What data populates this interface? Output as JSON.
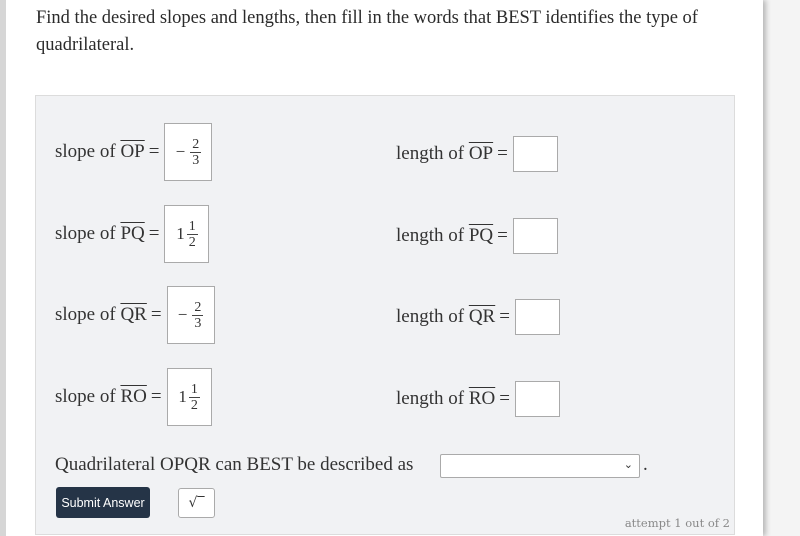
{
  "prompt": "Find the desired slopes and lengths, then fill in the words that BEST identifies the type of quadrilateral.",
  "rows": [
    {
      "slope_label": "slope of",
      "segment": "OP",
      "slope": {
        "sign": "−",
        "whole": "",
        "num": "2",
        "den": "3"
      },
      "length_label": "length of",
      "length_value": ""
    },
    {
      "slope_label": "slope of",
      "segment": "PQ",
      "slope": {
        "sign": "",
        "whole": "1",
        "num": "1",
        "den": "2"
      },
      "length_label": "length of",
      "length_value": ""
    },
    {
      "slope_label": "slope of",
      "segment": "QR",
      "slope": {
        "sign": "−",
        "whole": "",
        "num": "2",
        "den": "3"
      },
      "length_label": "length of",
      "length_value": ""
    },
    {
      "slope_label": "slope of",
      "segment": "RO",
      "slope": {
        "sign": "",
        "whole": "1",
        "num": "1",
        "den": "2"
      },
      "length_label": "length of",
      "length_value": ""
    }
  ],
  "equals": "=",
  "question": {
    "text": "Quadrilateral OPQR can BEST be described as",
    "selected": "",
    "period": "."
  },
  "buttons": {
    "submit": "Submit Answer",
    "sqrt": "√‾"
  },
  "attempt": "attempt 1 out of 2",
  "icons": {
    "chevron": "⌄"
  }
}
